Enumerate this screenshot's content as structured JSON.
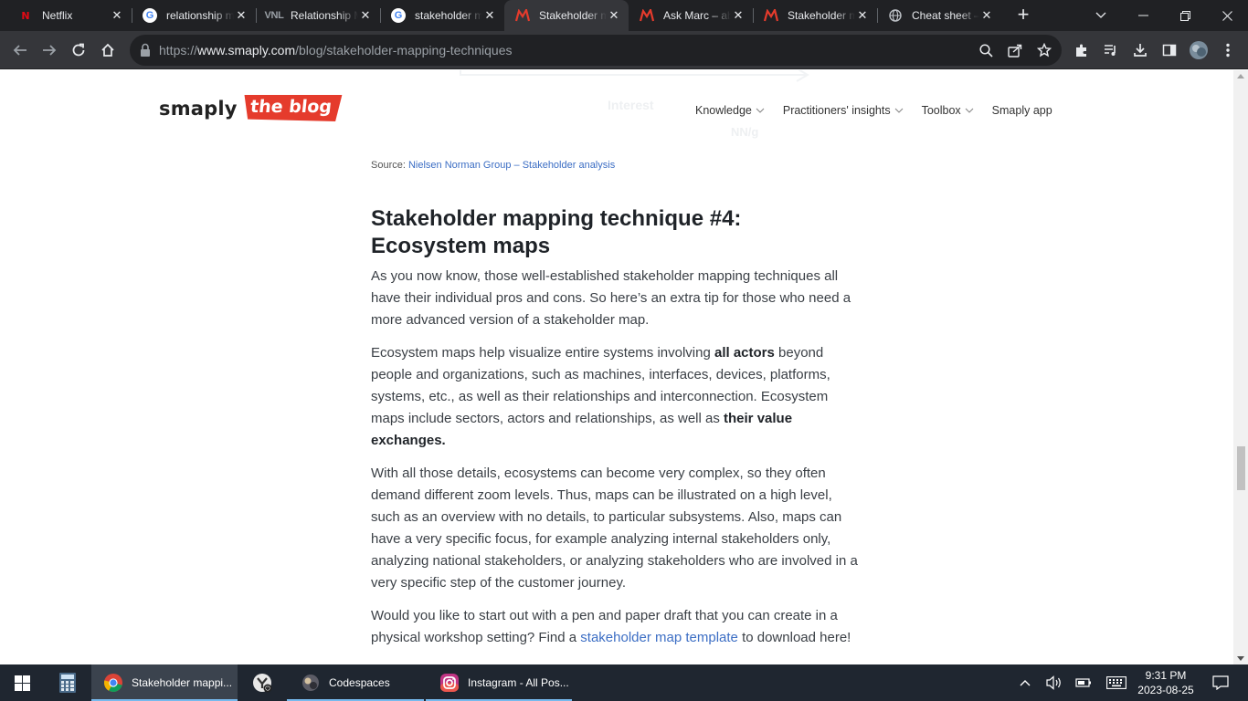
{
  "browser": {
    "tabs": [
      {
        "title": "Netflix",
        "favicon": "netflix-icon",
        "active": false
      },
      {
        "title": "relationship m",
        "favicon": "google-icon",
        "active": false
      },
      {
        "title": "Relationship M",
        "favicon": "vnl-icon",
        "active": false
      },
      {
        "title": "stakeholder m",
        "favicon": "google-icon",
        "active": false
      },
      {
        "title": "Stakeholder m",
        "favicon": "smaply-icon",
        "active": true
      },
      {
        "title": "Ask Marc – ab",
        "favicon": "smaply-icon",
        "active": false
      },
      {
        "title": "Stakeholder m",
        "favicon": "smaply-icon",
        "active": false
      },
      {
        "title": "Cheat sheet –",
        "favicon": "globe-icon",
        "active": false
      }
    ],
    "favicon_vnl_text": "VNL",
    "url": {
      "scheme": "https://",
      "host": "www.smaply.com",
      "path": "/blog/stakeholder-mapping-techniques"
    }
  },
  "site": {
    "logo_word": "smaply",
    "logo_badge": "the blog",
    "brand_color": "#e53b2c",
    "nav": [
      {
        "label": "Knowledge",
        "dropdown": true
      },
      {
        "label": "Practitioners' insights",
        "dropdown": true
      },
      {
        "label": "Toolbox",
        "dropdown": true
      },
      {
        "label": "Smaply app",
        "dropdown": false
      }
    ],
    "ghost_text": {
      "interest": "Interest",
      "nng": "NN/g"
    }
  },
  "article": {
    "source_prefix": "Source: ",
    "source_link": "Nielsen Norman Group – Stakeholder analysis",
    "heading": "Stakeholder mapping technique #4: Ecosystem maps",
    "p1": "As you now know, those well-established stakeholder mapping techniques all have their individual pros and cons. So here’s an extra tip for those who need a more advanced version of a stakeholder map.",
    "p2": {
      "t1": "Ecosystem maps help visualize entire systems involving ",
      "b1": "all actors",
      "t2": " beyond people and organizations, such as machines, interfaces, devices, platforms, systems, etc., as well as their relationships and interconnection. Ecosystem maps include sectors, actors and relationships, as well as ",
      "b2": "their value exchanges."
    },
    "p3": "With all those details, ecosystems can become very complex, so they often demand different zoom levels. Thus, maps can be illustrated on a high level, such as an overview with no details, to particular subsystems. Also, maps can have a very specific focus, for example analyzing internal stakeholders only, analyzing national stakeholders, or analyzing stakeholders who are involved in a very specific step of the customer journey.",
    "p4": {
      "t1": "Would you like to start out with a pen and paper draft that you can create in a physical workshop setting? Find a ",
      "link": "stakeholder map template",
      "t2": " to download here!"
    }
  },
  "taskbar": {
    "items": [
      {
        "label": "",
        "icon": "calculator-icon"
      },
      {
        "label": "Stakeholder mappi...",
        "icon": "chrome-icon",
        "active": true
      },
      {
        "label": "",
        "icon": "app-icon"
      },
      {
        "label": "Codespaces",
        "icon": "codespaces-icon"
      },
      {
        "label": "Instagram - All Pos...",
        "icon": "instagram-icon"
      }
    ],
    "time": "9:31 PM",
    "date": "2023-08-25"
  },
  "colors": {
    "accent": "#3c6ec4",
    "taskbar_highlight": "#76b9ed",
    "chrome_dark": "#202124"
  }
}
